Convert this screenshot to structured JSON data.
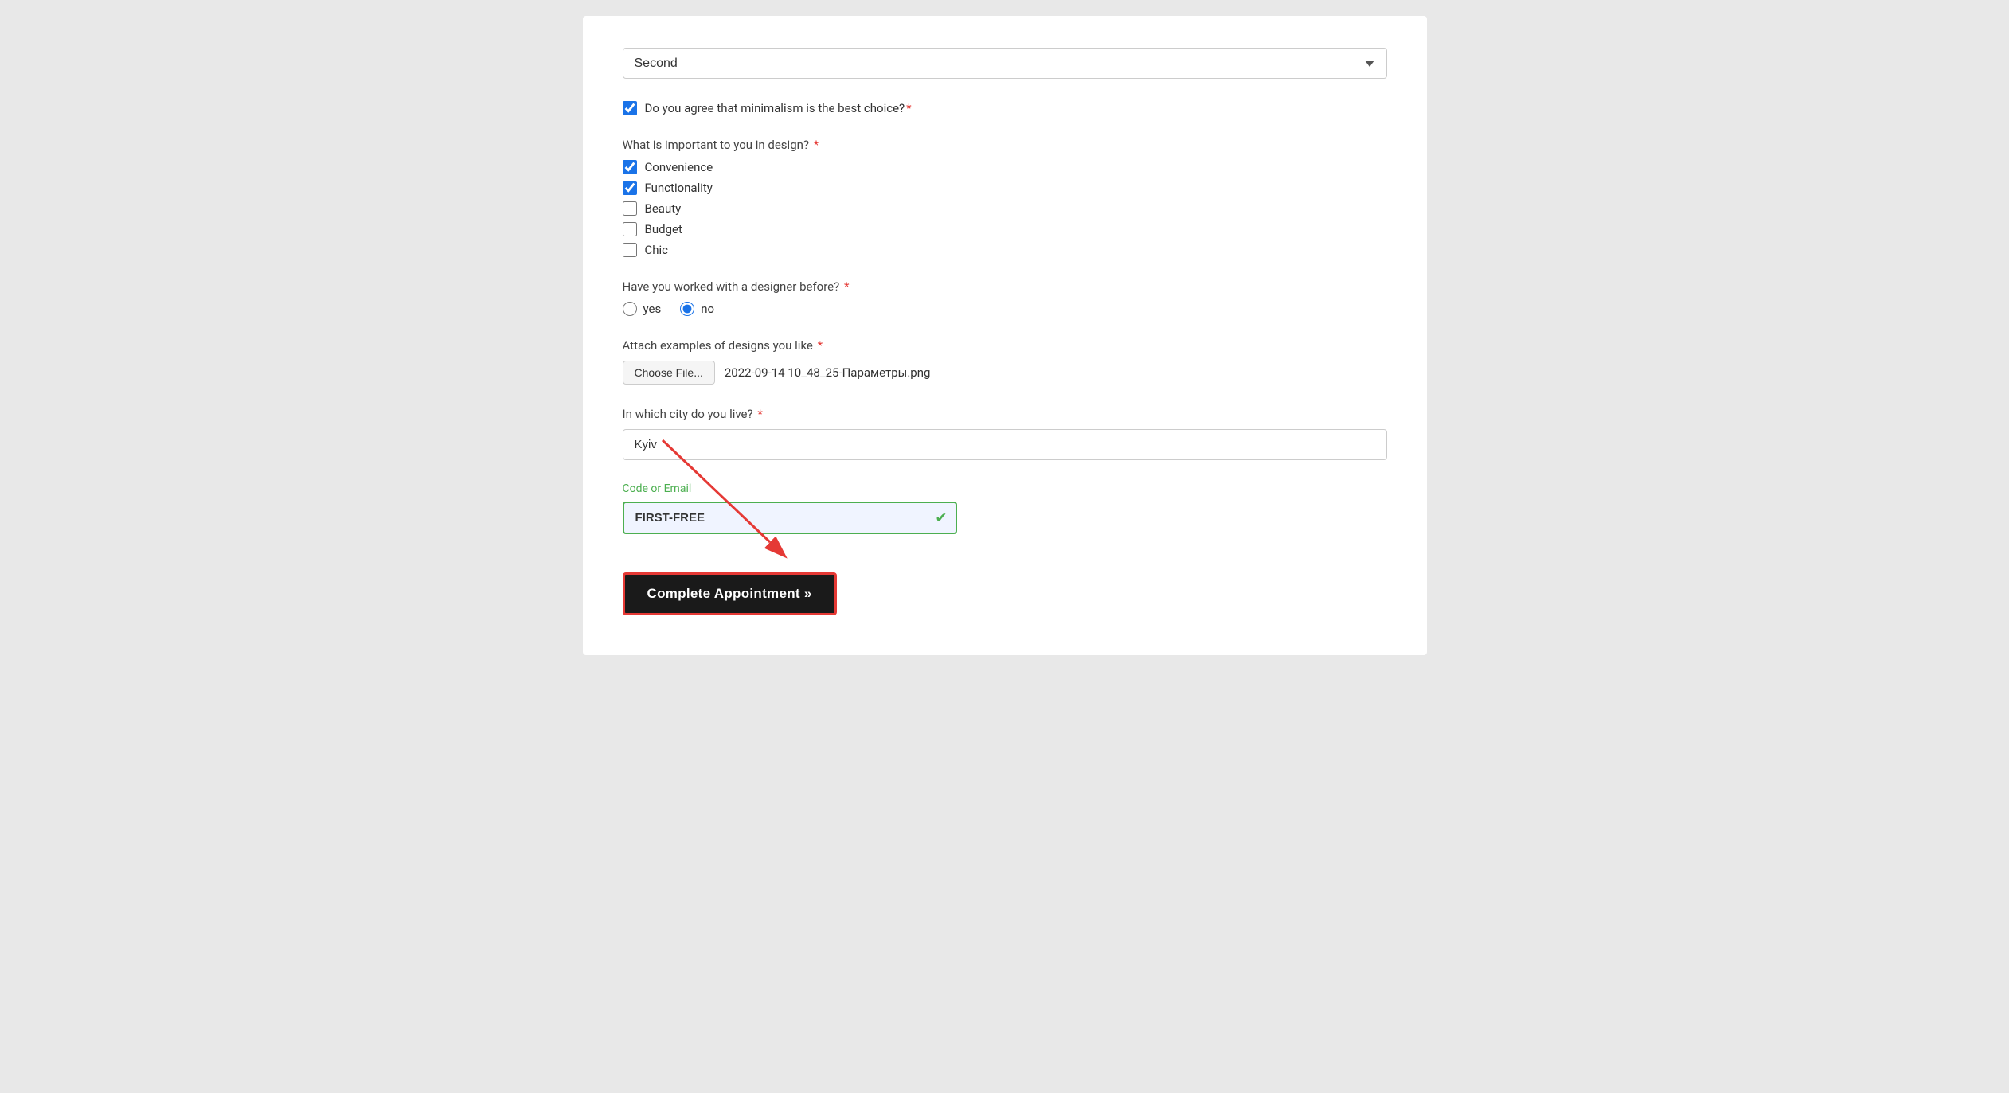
{
  "dropdown": {
    "selected": "Second"
  },
  "minimalism_question": {
    "label": "Do you agree that minimalism is the best choice?",
    "checked": true
  },
  "design_importance": {
    "label": "What is important to you in design?",
    "options": [
      {
        "label": "Convenience",
        "checked": true
      },
      {
        "label": "Functionality",
        "checked": true
      },
      {
        "label": "Beauty",
        "checked": false
      },
      {
        "label": "Budget",
        "checked": false
      },
      {
        "label": "Chic",
        "checked": false
      }
    ]
  },
  "designer_question": {
    "label": "Have you worked with a designer before?",
    "options": [
      {
        "label": "yes",
        "checked": false
      },
      {
        "label": "no",
        "checked": true
      }
    ]
  },
  "attach_label": "Attach examples of designs you like",
  "file_choose_btn": "Choose File...",
  "file_name": "2022-09-14 10_48_25-Параметры.png",
  "city_label": "In which city do you live?",
  "city_value": "Kyiv",
  "city_placeholder": "Kyiv",
  "code_label": "Code or Email",
  "code_value": "FIRST-FREE",
  "submit_label": "Complete Appointment »",
  "required_star": "*"
}
